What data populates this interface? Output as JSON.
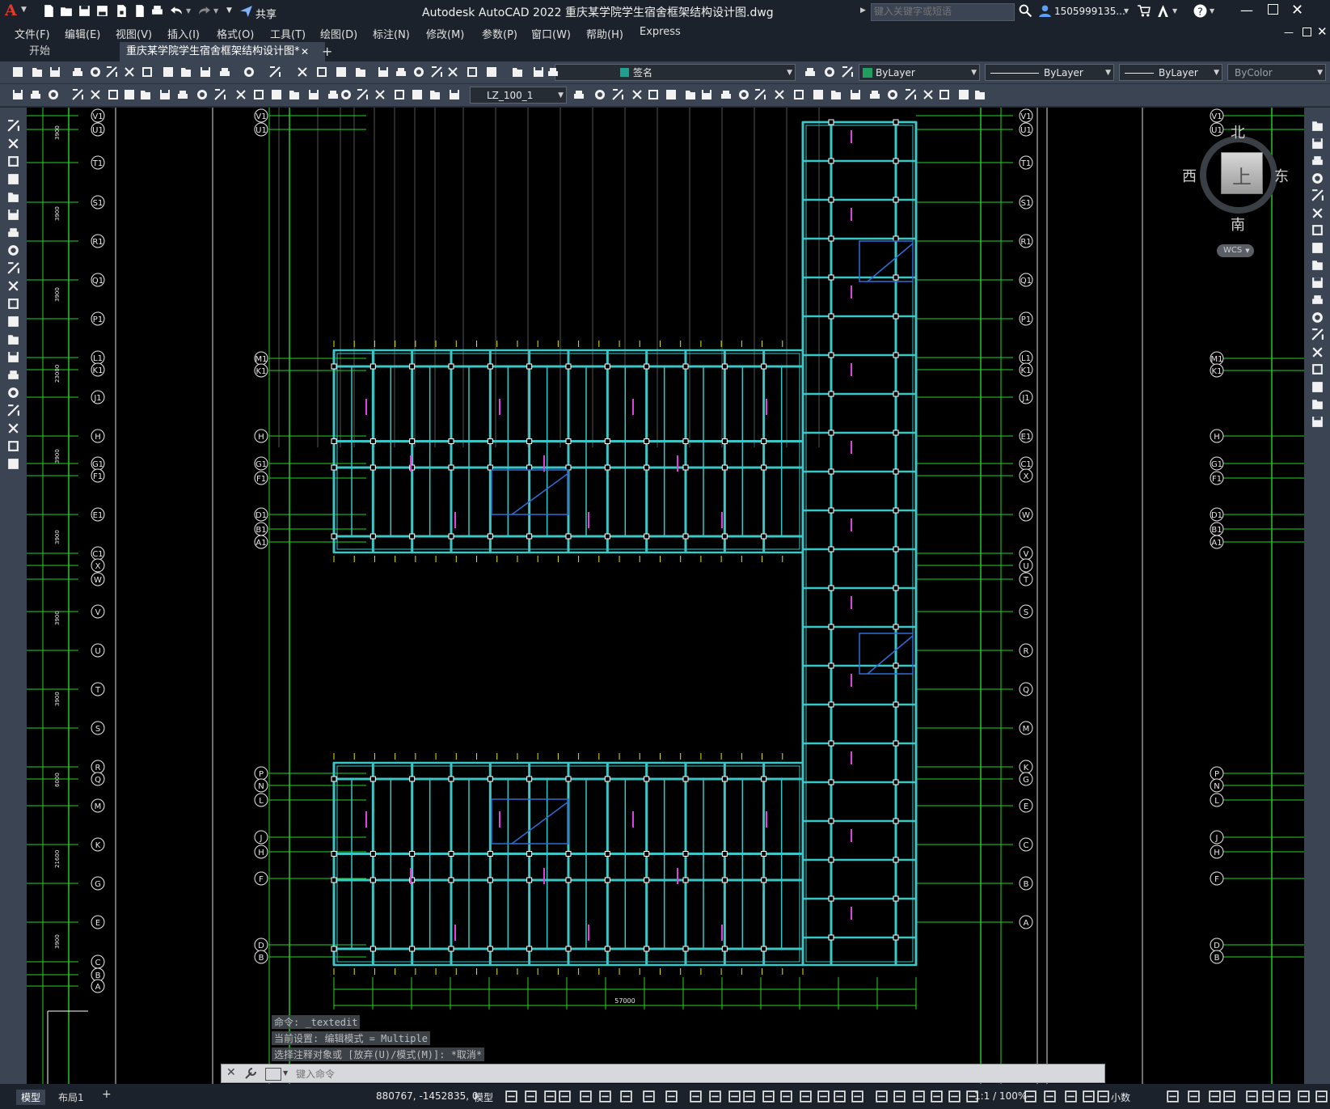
{
  "app": {
    "logo": "A",
    "title": "Autodesk AutoCAD 2022    重庆某学院学生宿舍框架结构设计图.dwg",
    "share_label": "共享",
    "search_placeholder": "键入关键字或短语",
    "user": "1505999135..."
  },
  "menu": [
    "文件(F)",
    "编辑(E)",
    "视图(V)",
    "插入(I)",
    "格式(O)",
    "工具(T)",
    "绘图(D)",
    "标注(N)",
    "修改(M)",
    "参数(P)",
    "窗口(W)",
    "帮助(H)",
    "Express"
  ],
  "tabs": {
    "start": "开始",
    "document": "重庆某学院学生宿舍框架结构设计图*",
    "add": "+"
  },
  "properties": {
    "layer": "签名",
    "color": "ByLayer",
    "linetype": "ByLayer",
    "lineweight": "ByLayer",
    "plotstyle": "ByColor",
    "style_combo": "LZ_100_1"
  },
  "colors": {
    "grid_axis": "#22d622",
    "beam": "#3cc6c6",
    "annotation": "#e040e0",
    "accent_blue": "#2d6fd6"
  },
  "viewcube": {
    "north": "北",
    "south": "南",
    "east": "东",
    "west": "西",
    "top": "上",
    "wcs": "WCS"
  },
  "axes": {
    "left": [
      "V1",
      "U1",
      "T1",
      "S1",
      "R1",
      "Q1",
      "P1",
      "L1",
      "K1",
      "J1",
      "H",
      "G1",
      "F1",
      "E1",
      "C1",
      "X",
      "W",
      "V",
      "U",
      "T",
      "S",
      "R",
      "Q",
      "M",
      "K",
      "G",
      "E",
      "C",
      "B",
      "A"
    ],
    "mid": [
      "V1",
      "U1",
      "M1",
      "K1",
      "H",
      "G1",
      "F1",
      "D1",
      "B1",
      "A1",
      "P",
      "N",
      "L",
      "J",
      "H",
      "F",
      "D",
      "B"
    ],
    "right_near": [
      "V1",
      "U1",
      "T1",
      "S1",
      "R1",
      "Q1",
      "P1",
      "L1",
      "K1",
      "J1",
      "E1",
      "C1",
      "X",
      "W",
      "V",
      "U",
      "T",
      "S",
      "R",
      "Q",
      "M",
      "K",
      "G",
      "E",
      "C",
      "B",
      "A"
    ],
    "right_far": [
      "V1",
      "U1",
      "M1",
      "K1",
      "H",
      "G1",
      "F1",
      "D1",
      "B1",
      "A1",
      "P",
      "N",
      "L",
      "J",
      "H",
      "F",
      "D",
      "B"
    ]
  },
  "dims": {
    "total_width": "57000",
    "sample_left": [
      "3900",
      "3900",
      "3900",
      "23000",
      "3900",
      "3900",
      "3900",
      "3900",
      "6000",
      "21600",
      "3900"
    ]
  },
  "command": {
    "history": [
      "命令: _textedit",
      "当前设置: 编辑模式 = Multiple",
      "选择注释对象或 [放弃(U)/模式(M)]: *取消*"
    ],
    "placeholder": "键入命令"
  },
  "status": {
    "model_tab": "模型",
    "layout_tab": "布局1",
    "coords": "880767, -1452835, 0",
    "model_label": "模型",
    "scale": "1:1 / 100%",
    "units": "小数"
  }
}
